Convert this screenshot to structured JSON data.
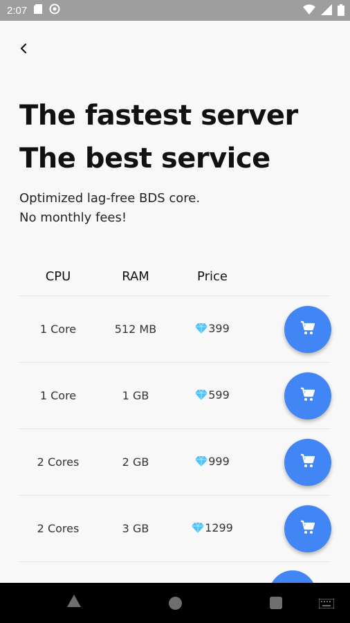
{
  "status_bar": {
    "time": "2:07"
  },
  "header": {
    "headline_line1": "The fastest server",
    "headline_line2": "The best service",
    "subtitle_line1": "Optimized lag-free BDS core.",
    "subtitle_line2": "No monthly fees!"
  },
  "table": {
    "columns": [
      "CPU",
      "RAM",
      "Price"
    ],
    "rows": [
      {
        "cpu": "1 Core",
        "ram": "512 MB",
        "price": "399"
      },
      {
        "cpu": "1 Core",
        "ram": "1 GB",
        "price": "599"
      },
      {
        "cpu": "2 Cores",
        "ram": "2 GB",
        "price": "999"
      },
      {
        "cpu": "2 Cores",
        "ram": "3 GB",
        "price": "1299"
      }
    ]
  },
  "colors": {
    "accent": "#4285f4",
    "status_bar": "#9e9e9e",
    "background": "#f8f8f8",
    "gem": "#4fc3f7"
  },
  "icons": {
    "back": "chevron-left-icon",
    "cart": "shopping-cart-icon",
    "currency": "diamond-gem-icon"
  }
}
